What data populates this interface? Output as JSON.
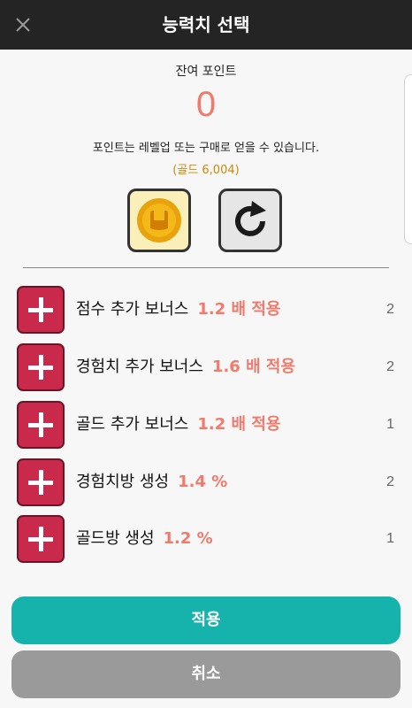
{
  "header": {
    "title": "능력치 선택",
    "close_icon": "close-icon"
  },
  "points": {
    "label": "잔여 포인트",
    "value": "0",
    "description": "포인트는 레벨업 또는 구매로 얻을 수 있습니다.",
    "gold": "(골드 6,004)"
  },
  "icons": {
    "coin": "rabbit-coin-icon",
    "reset": "refresh-icon"
  },
  "stats": [
    {
      "name": "점수 추가 보너스",
      "value": "1.2 배 적용",
      "count": "2"
    },
    {
      "name": "경험치 추가 보너스",
      "value": "1.6 배 적용",
      "count": "2"
    },
    {
      "name": "골드 추가 보너스",
      "value": "1.2 배 적용",
      "count": "1"
    },
    {
      "name": "경험치방 생성",
      "value": "1.4 %",
      "count": "2"
    },
    {
      "name": "골드방 생성",
      "value": "1.2 %",
      "count": "1"
    }
  ],
  "buttons": {
    "apply": "적용",
    "cancel": "취소"
  },
  "colors": {
    "header": "#242424",
    "accent_red": "#f07a6c",
    "plus_button": "#c9294b",
    "apply": "#16b3ad",
    "cancel": "#9a9a9a",
    "gold": "#c98a0a"
  }
}
